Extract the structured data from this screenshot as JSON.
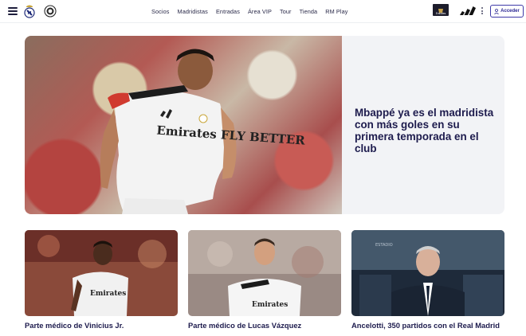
{
  "header": {
    "nav": [
      "Socios",
      "Madridistas",
      "Entradas",
      "Área VIP",
      "Tour",
      "Tienda",
      "RM Play"
    ],
    "sponsor_label": "Emirates",
    "login_label": "Acceder"
  },
  "hero": {
    "title": "Mbappé ya es el madridista con más goles en su primera temporada en el club",
    "shirt_text": "Emirates FLY BETTER"
  },
  "cards": [
    {
      "title": "Parte médico de Vinicius Jr."
    },
    {
      "title": "Parte médico de Lucas Vázquez"
    },
    {
      "title": "Ancelotti, 350 partidos con el Real Madrid"
    }
  ],
  "colors": {
    "text_dark": "#1d1b4d",
    "accent": "#3f3aa8",
    "hero_panel": "#f2f3f6"
  },
  "icons": [
    "menu-icon",
    "real-madrid-crest-icon",
    "club-crest-icon",
    "emirates-logo",
    "adidas-logo",
    "more-vertical-icon",
    "user-icon"
  ]
}
